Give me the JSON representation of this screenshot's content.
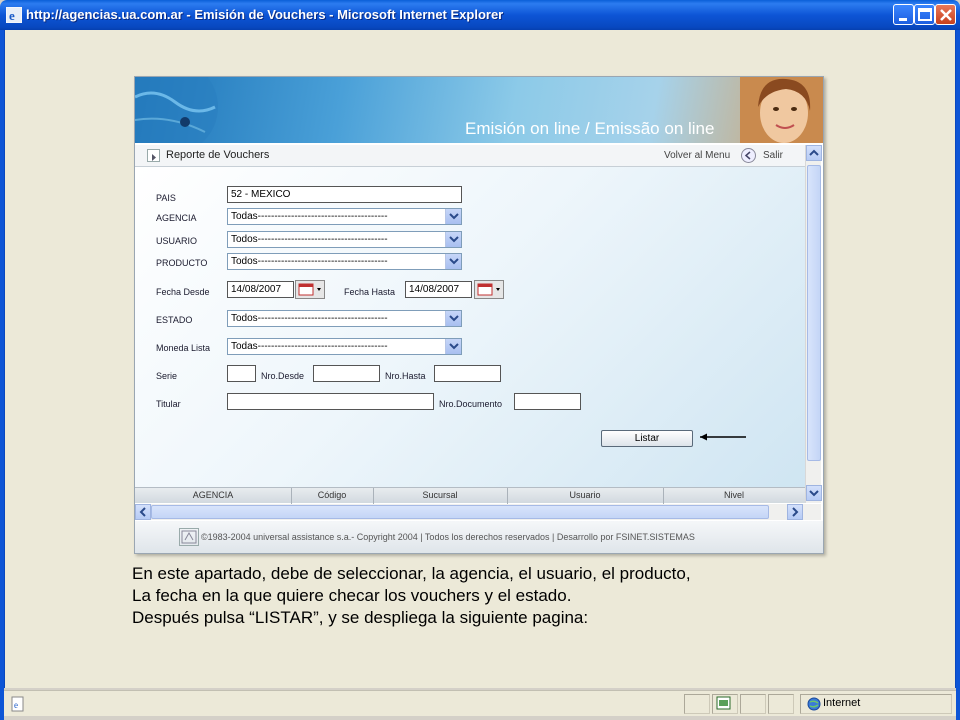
{
  "window": {
    "title": "http://agencias.ua.com.ar - Emisión de Vouchers - Microsoft Internet Explorer",
    "controls": [
      "minimize-icon",
      "maximize-icon",
      "close-icon"
    ]
  },
  "banner": {
    "title": "Emisión on line / Emissão on line"
  },
  "toolbar": {
    "title": "Reporte de Vouchers",
    "volver_label": "Volver al Menu",
    "salir_label": "Salir"
  },
  "form": {
    "pais_label": "PAIS",
    "pais_value": "52 - MEXICO",
    "agencia_label": "AGENCIA",
    "agencia_value": "Todas---------------------------------------",
    "usuario_label": "USUARIO",
    "usuario_value": "Todos---------------------------------------",
    "producto_label": "PRODUCTO",
    "producto_value": "Todos---------------------------------------",
    "fecha_desde_label": "Fecha Desde",
    "fecha_desde_value": "14/08/2007",
    "fecha_hasta_label": "Fecha Hasta",
    "fecha_hasta_value": "14/08/2007",
    "estado_label": "ESTADO",
    "estado_value": "Todos---------------------------------------",
    "moneda_label": "Moneda Lista",
    "moneda_value": "Todas---------------------------------------",
    "serie_label": "Serie",
    "serie_value": "",
    "nro_desde_label": "Nro.Desde",
    "nro_desde_value": "",
    "nro_hasta_label": "Nro.Hasta",
    "nro_hasta_value": "",
    "titular_label": "Titular",
    "titular_value": "",
    "nro_documento_label": "Nro.Documento",
    "nro_documento_value": "",
    "listar_label": "Listar"
  },
  "table": {
    "columns": [
      "AGENCIA",
      "Código",
      "Sucursal",
      "Usuario",
      "Nivel"
    ]
  },
  "footer": {
    "text": "©1983-2004 universal assistance s.a.- Copyright 2004 | Todos los derechos reservados | Desarrollo por FSINET.SISTEMAS"
  },
  "caption": {
    "line1": "En este apartado, debe de seleccionar, la agencia, el usuario, el producto,",
    "line2": "La fecha en la que quiere checar los vouchers y el estado.",
    "line3": "Después pulsa “LISTAR”, y se despliega la siguiente pagina:"
  },
  "statusbar": {
    "zone": "Internet"
  },
  "colors": {
    "titlebar": "#0d55d6",
    "chrome": "#ece9d8",
    "banner": "#4aa0d8"
  }
}
